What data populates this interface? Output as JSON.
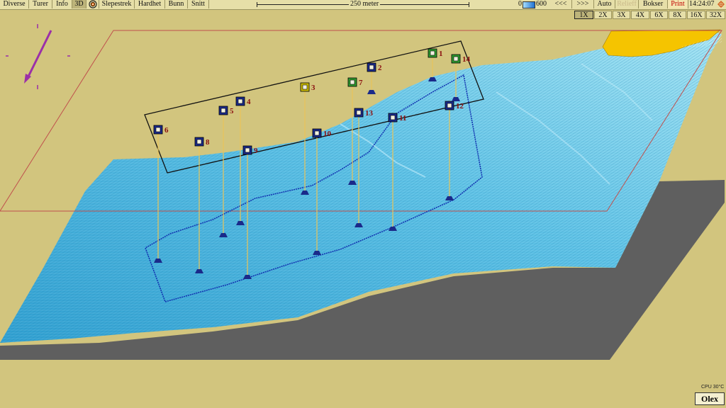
{
  "toolbar": {
    "diverse": "Diverse",
    "turer": "Turer",
    "info": "Info",
    "view3d": "3D",
    "slepestrek": "Slepestrek",
    "hardhet": "Hardhet",
    "bunn": "Bunn",
    "snitt": "Snitt",
    "scale": "250 meter",
    "depth_min": "0",
    "depth_max": "600",
    "nav_back": "<<<",
    "nav_forward": ">>>",
    "auto": "Auto",
    "relieff": "Relieff",
    "bokser": "Bokser",
    "print": "Print",
    "clock": "14:24:07"
  },
  "zoom_levels": [
    "1X",
    "2X",
    "3X",
    "4X",
    "6X",
    "8X",
    "16X",
    "32X"
  ],
  "zoom_active": "1X",
  "markers": [
    {
      "id": "1",
      "type": "green"
    },
    {
      "id": "2",
      "type": "navy"
    },
    {
      "id": "3",
      "type": "yellow"
    },
    {
      "id": "4",
      "type": "navy"
    },
    {
      "id": "5",
      "type": "navy"
    },
    {
      "id": "6",
      "type": "navy"
    },
    {
      "id": "7",
      "type": "green"
    },
    {
      "id": "8",
      "type": "navy"
    },
    {
      "id": "9",
      "type": "navy"
    },
    {
      "id": "10",
      "type": "navy"
    },
    {
      "id": "11",
      "type": "navy"
    },
    {
      "id": "12",
      "type": "navy"
    },
    {
      "id": "13",
      "type": "navy"
    },
    {
      "id": "14",
      "type": "green"
    }
  ],
  "colors": {
    "background": "#d2c57e",
    "seabed_light": "#7fd6ee",
    "seabed_dark": "#2f9fd0",
    "land": "#f5c400",
    "shadow": "#5f5f5f",
    "frame": "#c0504d",
    "track": "#1030b0",
    "compass": "#9b2fa8"
  },
  "footer": {
    "cpu": "CPU 30°C",
    "logo": "Olex"
  }
}
